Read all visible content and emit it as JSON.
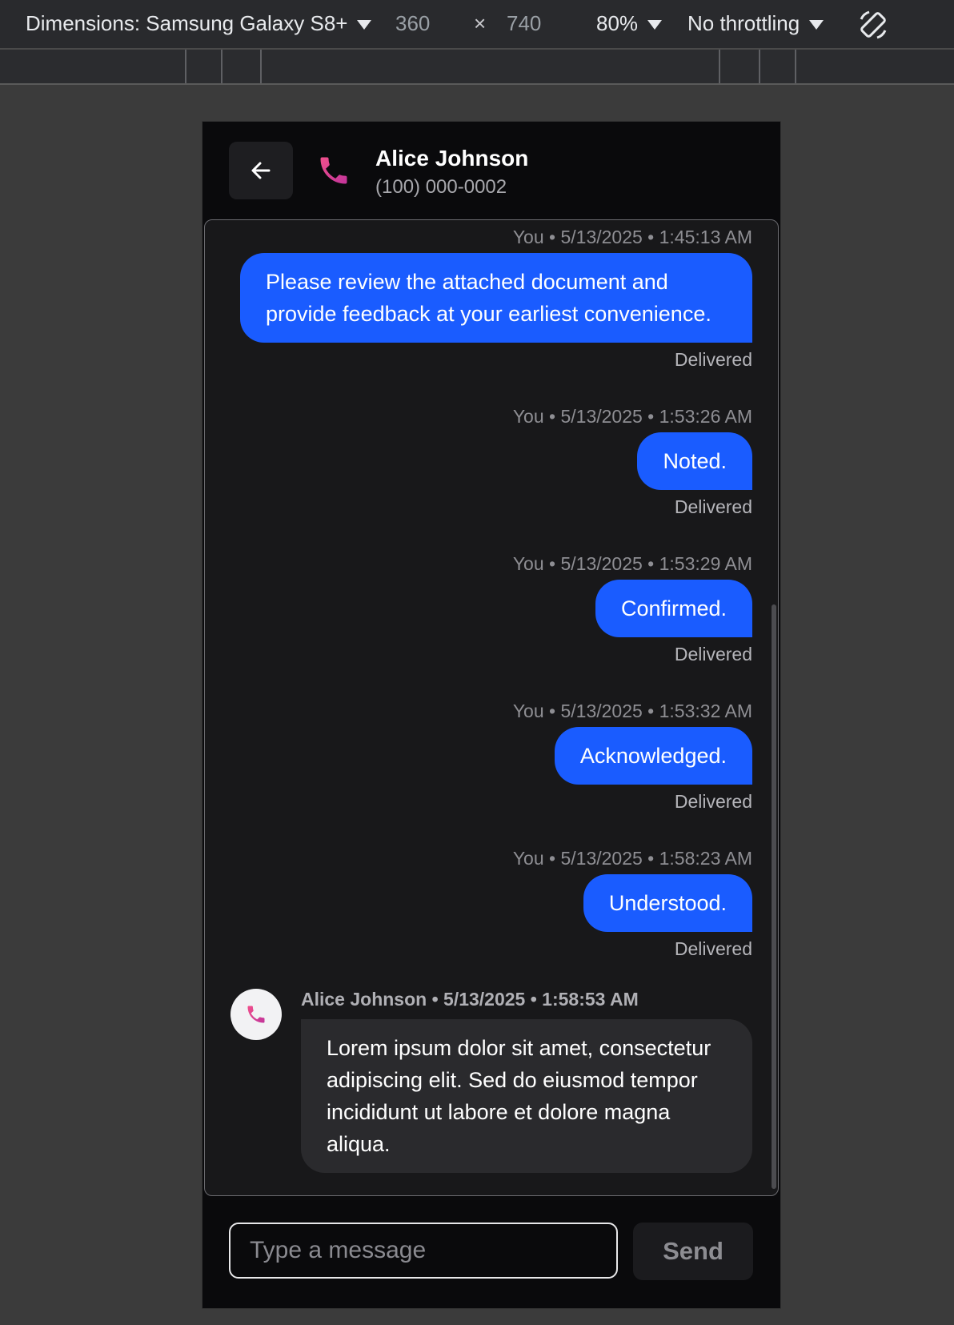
{
  "devtools": {
    "dimensions_label": "Dimensions: Samsung Galaxy S8+",
    "width": "360",
    "times": "×",
    "height": "740",
    "zoom": "80%",
    "throttling": "No throttling"
  },
  "header": {
    "contact_name": "Alice Johnson",
    "contact_number": "(100) 000-0002"
  },
  "colors": {
    "accent": "#1a5cff",
    "phone_icon_start": "#f0508c",
    "phone_icon_end": "#c2349a"
  },
  "messages_out": [
    {
      "meta": "You • 5/13/2025 • 1:45:13 AM",
      "text": "Please review the attached document and provide feedback at your earliest convenience.",
      "status": "Delivered"
    },
    {
      "meta": "You • 5/13/2025 • 1:53:26 AM",
      "text": "Noted.",
      "status": "Delivered"
    },
    {
      "meta": "You • 5/13/2025 • 1:53:29 AM",
      "text": "Confirmed.",
      "status": "Delivered"
    },
    {
      "meta": "You • 5/13/2025 • 1:53:32 AM",
      "text": "Acknowledged.",
      "status": "Delivered"
    },
    {
      "meta": "You • 5/13/2025 • 1:58:23 AM",
      "text": "Understood.",
      "status": "Delivered"
    }
  ],
  "message_in": {
    "meta": "Alice Johnson • 5/13/2025 • 1:58:53 AM",
    "text": "Lorem ipsum dolor sit amet, consectetur adipiscing elit. Sed do eiusmod tempor incididunt ut labore et dolore magna aliqua."
  },
  "composer": {
    "placeholder": "Type a message",
    "send_label": "Send"
  }
}
